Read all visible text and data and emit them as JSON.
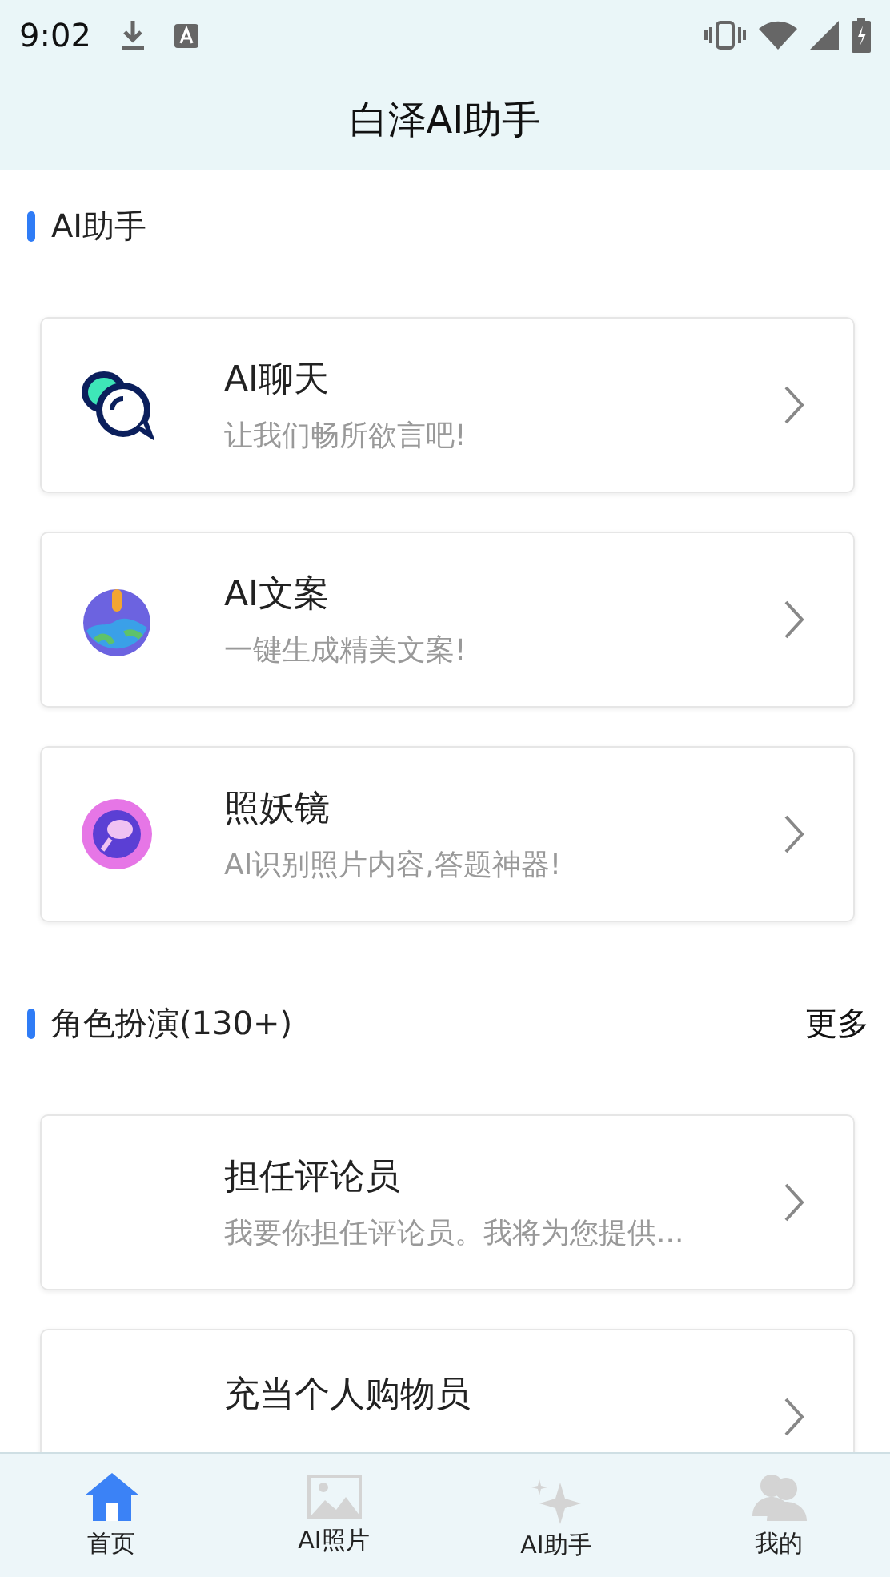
{
  "status_bar": {
    "time": "9:02"
  },
  "header": {
    "title": "白泽AI助手"
  },
  "sections": [
    {
      "title": "AI助手",
      "cards": [
        {
          "title": "AI聊天",
          "subtitle": "让我们畅所欲言吧!"
        },
        {
          "title": "AI文案",
          "subtitle": "一键生成精美文案!"
        },
        {
          "title": "照妖镜",
          "subtitle": "AI识别照片内容,答题神器!"
        }
      ]
    },
    {
      "title": "角色扮演(130+)",
      "more": "更多",
      "cards": [
        {
          "title": "担任评论员",
          "subtitle": "我要你担任评论员。我将为您提供..."
        },
        {
          "title": "充当个人购物员"
        }
      ]
    }
  ],
  "tabs": [
    {
      "label": "首页",
      "selected": true
    },
    {
      "label": "AI照片",
      "selected": false
    },
    {
      "label": "AI助手",
      "selected": false
    },
    {
      "label": "我的",
      "selected": false
    }
  ]
}
